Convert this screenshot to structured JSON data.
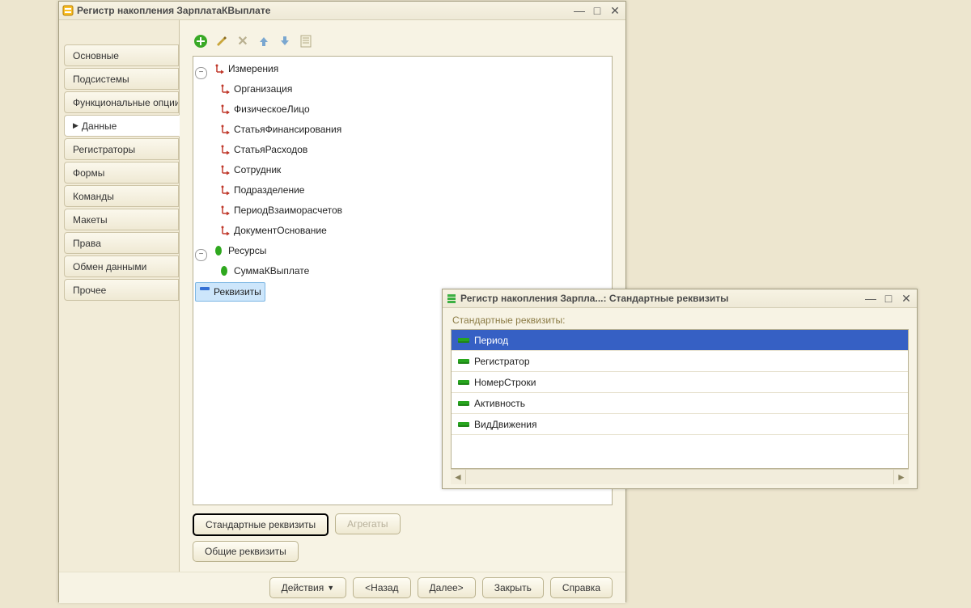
{
  "main": {
    "title": "Регистр накопления ЗарплатаКВыплате",
    "sidebar": {
      "items": [
        "Основные",
        "Подсистемы",
        "Функциональные опции",
        "Данные",
        "Регистраторы",
        "Формы",
        "Команды",
        "Макеты",
        "Права",
        "Обмен данными",
        "Прочее"
      ],
      "active_index": 3
    },
    "tree": {
      "dimensions": {
        "label": "Измерения",
        "items": [
          "Организация",
          "ФизическоеЛицо",
          "СтатьяФинансирования",
          "СтатьяРасходов",
          "Сотрудник",
          "Подразделение",
          "ПериодВзаиморасчетов",
          "ДокументОснование"
        ]
      },
      "resources": {
        "label": "Ресурсы",
        "items": [
          "СуммаКВыплате"
        ]
      },
      "requisites": {
        "label": "Реквизиты"
      }
    },
    "buttons": {
      "standard_req": "Стандартные реквизиты",
      "aggregates": "Агрегаты",
      "common_req": "Общие реквизиты"
    },
    "footer": {
      "actions": "Действия",
      "back": "<Назад",
      "next": "Далее>",
      "close": "Закрыть",
      "help": "Справка"
    }
  },
  "popup": {
    "title": "Регистр накопления Зарпла...: Стандартные реквизиты",
    "caption": "Стандартные реквизиты:",
    "rows": [
      "Период",
      "Регистратор",
      "НомерСтроки",
      "Активность",
      "ВидДвижения"
    ],
    "selected_index": 0
  }
}
